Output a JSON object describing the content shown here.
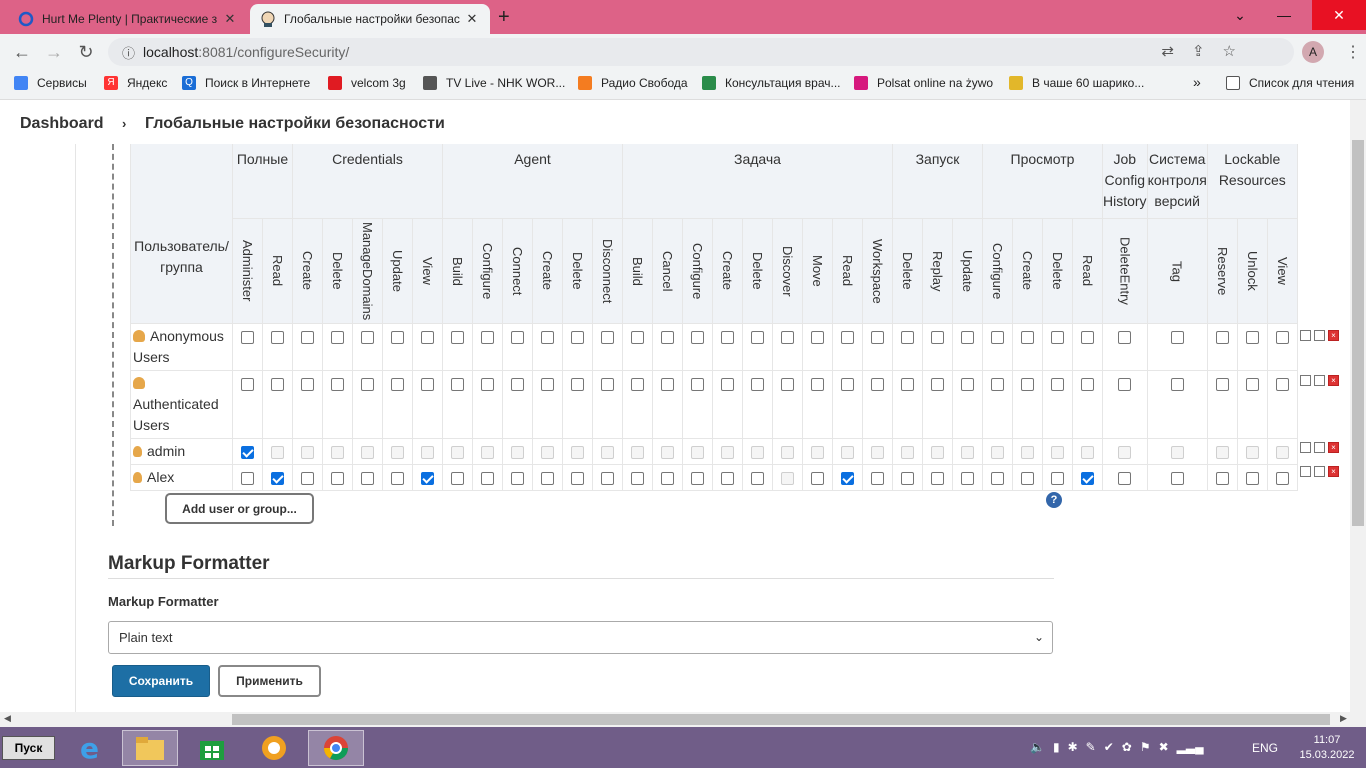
{
  "browser": {
    "tabs": [
      {
        "title": "Hurt Me Plenty | Практические з",
        "active": false
      },
      {
        "title": "Глобальные настройки безопас",
        "active": true
      }
    ],
    "url_host": "localhost",
    "url_path": ":8081/configureSecurity/",
    "profile_initial": "A"
  },
  "bookmarks": [
    {
      "label": "Сервисы",
      "icon": "apps-grid-icon",
      "color": "#4285f4"
    },
    {
      "label": "Яндекс",
      "icon": "yandex-icon",
      "color": "#ff3333"
    },
    {
      "label": "Поиск в Интернете",
      "icon": "search-icon",
      "color": "#1a6dd6"
    },
    {
      "label": "velcom 3g",
      "icon": "huawei-icon",
      "color": "#e01b22"
    },
    {
      "label": "TV Live - NHK WOR...",
      "icon": "nhk-icon",
      "color": "#555555"
    },
    {
      "label": "Радио Свобода",
      "icon": "radio-icon",
      "color": "#f47c20"
    },
    {
      "label": "Консультация врач...",
      "icon": "doctor-icon",
      "color": "#2a8c4a"
    },
    {
      "label": "Polsat online na żywo",
      "icon": "polsat-icon",
      "color": "#d6187d"
    },
    {
      "label": "В чаше 60 шарико...",
      "icon": "key-icon",
      "color": "#e2b72a"
    }
  ],
  "bookmarks_more": "»",
  "reading_list": "Список для чтения",
  "breadcrumb": {
    "root": "Dashboard",
    "separator": "›",
    "current": "Глобальные настройки безопасности"
  },
  "matrix": {
    "user_header": "Пользователь/ группа",
    "groups": [
      {
        "label": "Полные",
        "cols": 2
      },
      {
        "label": "Credentials",
        "cols": 5
      },
      {
        "label": "Agent",
        "cols": 6
      },
      {
        "label": "Задача",
        "cols": 9
      },
      {
        "label": "Запуск",
        "cols": 3
      },
      {
        "label": "Просмотр",
        "cols": 4
      },
      {
        "label": "Job Config History",
        "cols": 1
      },
      {
        "label": "Система контроля версий",
        "cols": 1
      },
      {
        "label": "Lockable Resources",
        "cols": 3
      }
    ],
    "columns": [
      "Administer",
      "Read",
      "Create",
      "Delete",
      "ManageDomains",
      "Update",
      "View",
      "Build",
      "Configure",
      "Connect",
      "Create",
      "Delete",
      "Disconnect",
      "Build",
      "Cancel",
      "Configure",
      "Create",
      "Delete",
      "Discover",
      "Move",
      "Read",
      "Workspace",
      "Delete",
      "Replay",
      "Update",
      "Configure",
      "Create",
      "Delete",
      "Read",
      "DeleteEntry",
      "Tag",
      "Reserve",
      "Unlock",
      "View"
    ],
    "rows": [
      {
        "name": "Anonymous Users",
        "type": "group",
        "checked": [],
        "disabled": [],
        "all_disabled": false
      },
      {
        "name": "Authenticated Users",
        "type": "group",
        "checked": [],
        "disabled": [],
        "all_disabled": false
      },
      {
        "name": "admin",
        "type": "user",
        "checked": [
          0
        ],
        "disabled": [],
        "all_disabled": true
      },
      {
        "name": "Alex",
        "type": "user",
        "checked": [
          1,
          6,
          20,
          28
        ],
        "disabled": [
          18
        ],
        "all_disabled": false
      }
    ],
    "add_button": "Add user or group...",
    "help": "?"
  },
  "markup": {
    "section_title": "Markup Formatter",
    "field_label": "Markup Formatter",
    "selected": "Plain text"
  },
  "actions": {
    "save": "Сохранить",
    "apply": "Применить"
  },
  "taskbar": {
    "start": "Пуск",
    "lang": "ENG",
    "time": "11:07",
    "date": "15.03.2022"
  }
}
